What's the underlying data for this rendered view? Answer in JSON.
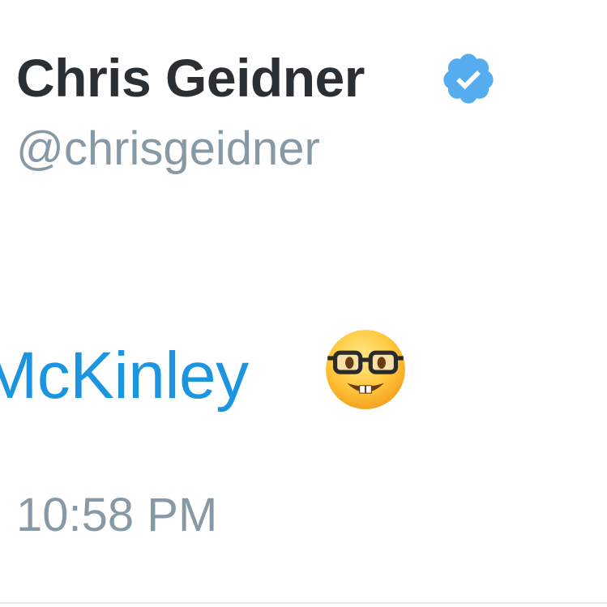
{
  "tweet": {
    "author": {
      "display_name": "Chris Geidner",
      "handle": "@chrisgeidner",
      "verified": true
    },
    "text_visible": "McKinley",
    "emoji": "nerd-face-icon",
    "timestamp": "10:58 PM"
  },
  "colors": {
    "name": "#292f33",
    "handle": "#8899a6",
    "link": "#1b95e0",
    "verified_badge": "#55acee",
    "divider": "#e1e8ed"
  }
}
